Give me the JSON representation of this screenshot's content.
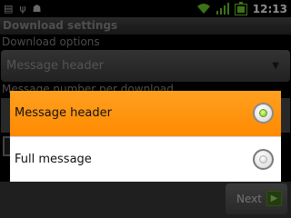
{
  "status_bar": {
    "time": "12:13",
    "left_icons": [
      "text-icon",
      "usb-icon",
      "android-icon"
    ],
    "right_icons": [
      "wifi-icon",
      "signal-icon",
      "battery-icon"
    ]
  },
  "title": "Download settings",
  "background": {
    "download_options_label": "Download options",
    "download_options_value": "Message header",
    "message_number_label": "Message number per download",
    "next_label": "Next"
  },
  "dialog": {
    "options": [
      {
        "label": "Message header",
        "selected": true
      },
      {
        "label": "Full message",
        "selected": false
      }
    ],
    "accent_color": "#ff9510"
  }
}
